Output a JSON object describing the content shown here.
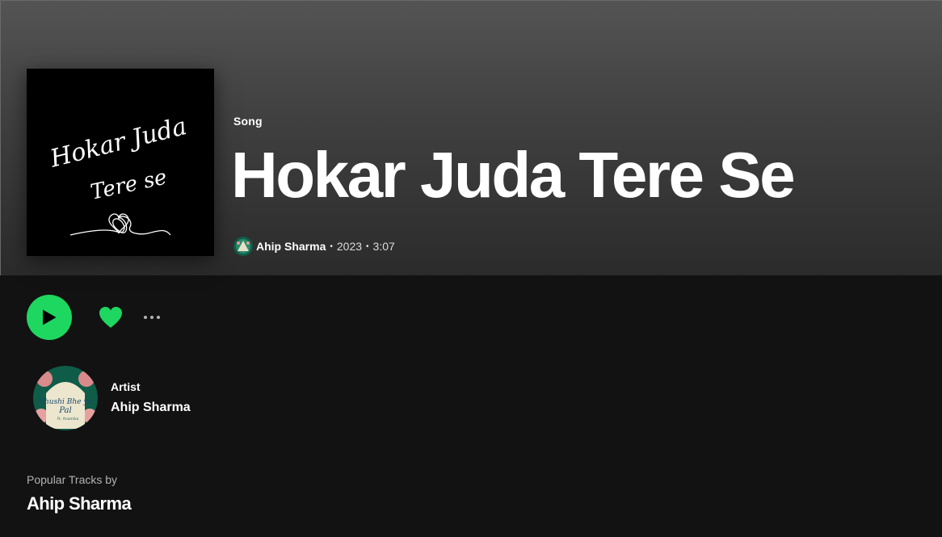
{
  "header": {
    "type_label": "Song",
    "title": "Hokar Juda Tere Se",
    "cover_art": {
      "line1": "Hokar Juda",
      "line2": "Tere se"
    },
    "byline": {
      "artist": "Ahip Sharma",
      "year": "2023",
      "duration": "3:07",
      "separator": "•"
    }
  },
  "actions": {
    "play_icon": "play-icon",
    "heart_icon": "heart-filled-icon",
    "more_icon": "more-dots-icon",
    "accent_color": "#1ed760"
  },
  "artist_card": {
    "kicker": "Artist",
    "name": "Ahip Sharma",
    "avatar_art": {
      "line1": "Khushi Bhe ye",
      "line2": "Pal",
      "line3": "Ft. Anamika"
    }
  },
  "popular": {
    "kicker": "Popular Tracks by",
    "artist": "Ahip Sharma"
  }
}
